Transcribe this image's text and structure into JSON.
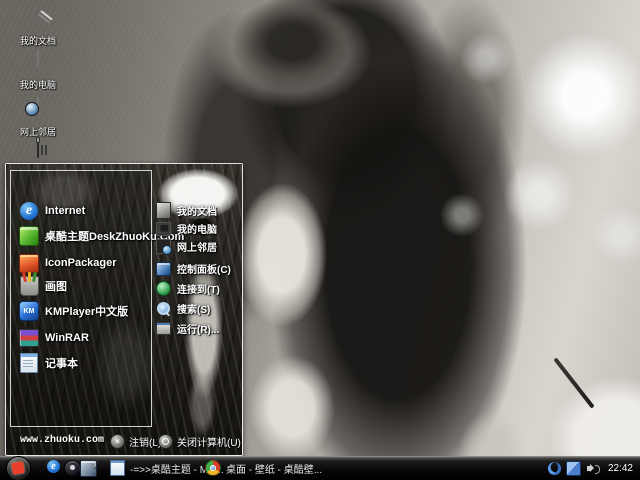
{
  "desktop": {
    "icons": [
      {
        "label": "我的文档",
        "icon": "my-documents-icon"
      },
      {
        "label": "我的电脑",
        "icon": "my-computer-icon"
      },
      {
        "label": "网上邻居",
        "icon": "network-places-icon"
      },
      {
        "label": "",
        "icon": "recycle-bin-icon"
      }
    ]
  },
  "start_menu": {
    "left_items": [
      {
        "label": "Internet",
        "icon": "internet-explorer-icon",
        "glyph": "e"
      },
      {
        "label": "桌酷主题DeskZhuoKu.Com",
        "icon": "zhuoku-theme-icon"
      },
      {
        "label": "IconPackager",
        "icon": "iconpackager-icon"
      },
      {
        "label": "画图",
        "icon": "paint-icon"
      },
      {
        "label": "KMPlayer中文版",
        "icon": "kmplayer-icon",
        "glyph": "KM"
      },
      {
        "label": "WinRAR",
        "icon": "winrar-icon"
      },
      {
        "label": "记事本",
        "icon": "notepad-icon"
      }
    ],
    "right_items": [
      {
        "label": "我的文档",
        "icon": "my-documents-icon"
      },
      {
        "label": "我的电脑",
        "icon": "my-computer-icon"
      },
      {
        "label": "网上邻居",
        "icon": "network-places-icon"
      },
      {
        "label": "控制面板(C)",
        "icon": "control-panel-icon"
      },
      {
        "label": "连接到(T)",
        "icon": "connect-to-icon"
      },
      {
        "label": "搜索(S)",
        "icon": "search-icon"
      },
      {
        "label": "运行(R)...",
        "icon": "run-icon"
      }
    ],
    "footer": {
      "website": "www.zhuoku.com",
      "log_off_label": "注销(L)",
      "turn_off_label": "关闭计算机(U)"
    }
  },
  "taskbar": {
    "overflow_glyph": "›",
    "quick_launch": [
      {
        "icon": "internet-explorer-icon",
        "glyph": "e"
      },
      {
        "icon": "media-player-icon"
      },
      {
        "icon": "browser-window-icon"
      }
    ],
    "tasks": [
      {
        "label": "-=>>桌酷主题 - Mic...",
        "icon": "document-icon"
      },
      {
        "label": "桌面 - 壁纸 - 桌酷壁...",
        "icon": "chrome-icon"
      }
    ],
    "tray": {
      "icons": [
        "input-method-icon",
        "network-icon",
        "volume-icon"
      ],
      "clock": "22:42"
    }
  },
  "colors": {
    "taskbar_black": "#080808",
    "menu_border": "#f5f5f5",
    "text_white": "#ffffff",
    "ie_blue": "#1d6fd0"
  }
}
